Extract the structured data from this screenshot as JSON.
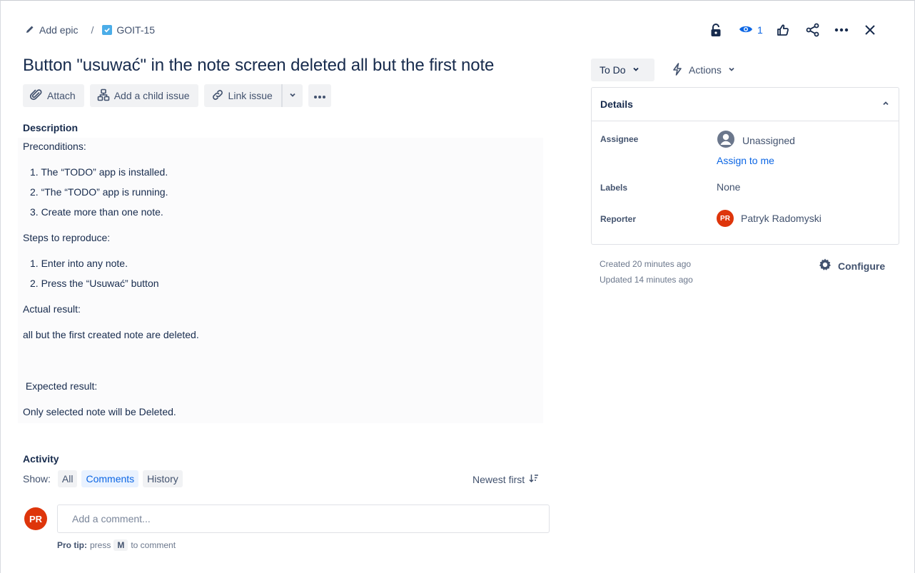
{
  "breadcrumb": {
    "epic_label": "Add epic",
    "separator": "/",
    "issue_key": "GOIT-15"
  },
  "toolbar": {
    "watch_count": "1"
  },
  "issue": {
    "title": "Button \"usuwać\" in the note screen deleted all but the first note"
  },
  "actions": {
    "attach": "Attach",
    "add_child": "Add a child issue",
    "link_issue": "Link issue"
  },
  "description": {
    "label": "Description",
    "preconditions_heading": "Preconditions:",
    "preconditions": [
      "1. The “TODO” app is installed.",
      "2. “The “TODO” app is running.",
      "3. Create more than one note."
    ],
    "steps_heading": "Steps to reproduce:",
    "steps": [
      "1. Enter into any note.",
      "2. Press the “Usuwać” button"
    ],
    "actual_heading": "Actual result:",
    "actual_text": "all but the first created note are deleted.",
    "expected_heading": " Expected result:",
    "expected_text": "Only selected note will be Deleted."
  },
  "activity": {
    "label": "Activity",
    "show_label": "Show:",
    "filters": [
      "All",
      "Comments",
      "History"
    ],
    "selected_filter": "Comments",
    "sort_label": "Newest first",
    "avatar_initials": "PR",
    "comment_placeholder": "Add a comment...",
    "protip_bold": "Pro tip:",
    "protip_press": "press",
    "protip_key": "M",
    "protip_rest": "to comment"
  },
  "sidebar": {
    "status": "To Do",
    "actions_label": "Actions",
    "details_title": "Details",
    "assignee_label": "Assignee",
    "assignee_value": "Unassigned",
    "assign_to_me": "Assign to me",
    "labels_label": "Labels",
    "labels_value": "None",
    "reporter_label": "Reporter",
    "reporter_initials": "PR",
    "reporter_name": "Patryk Radomyski",
    "created": "Created 20 minutes ago",
    "updated": "Updated 14 minutes ago",
    "configure": "Configure"
  },
  "colors": {
    "accent": "#0c66e4",
    "avatar_bg": "#de350b",
    "checkbox": "#4bade8"
  }
}
